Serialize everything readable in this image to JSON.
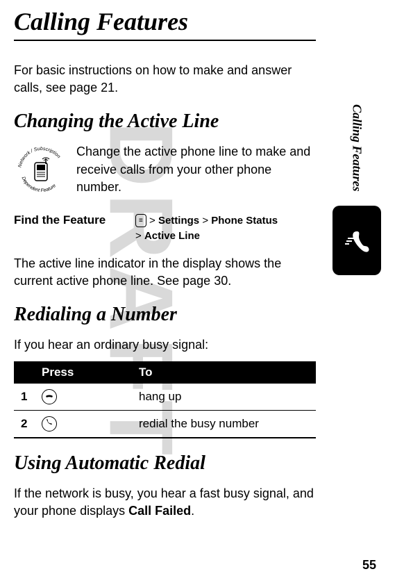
{
  "watermark": "DRAFT",
  "sidebar_text": "Calling Features",
  "page_title": "Calling Features",
  "intro_text": "For basic instructions on how to make and answer calls, see page 21.",
  "section1": {
    "heading": "Changing the Active Line",
    "intro": "Change the active phone line to make and receive calls from your other phone number.",
    "find_label": "Find the Feature",
    "path_line1_prefix": ">",
    "path_line1_a": "Settings",
    "path_line1_sep": ">",
    "path_line1_b": "Phone Status",
    "path_line2_prefix": ">",
    "path_line2_a": "Active Line",
    "after": "The active line indicator in the display shows the current active phone line. See page 30."
  },
  "section2": {
    "heading": "Redialing a Number",
    "intro": "If you hear an ordinary busy signal:",
    "table": {
      "col1": "Press",
      "col2": "To",
      "rows": [
        {
          "num": "1",
          "action": "hang up"
        },
        {
          "num": "2",
          "action": "redial the busy number"
        }
      ]
    }
  },
  "section3": {
    "heading": "Using Automatic Redial",
    "intro_pre": "If the network is busy, you hear a fast busy signal, and your phone displays ",
    "intro_bold": "Call Failed",
    "intro_post": "."
  },
  "page_number": "55"
}
